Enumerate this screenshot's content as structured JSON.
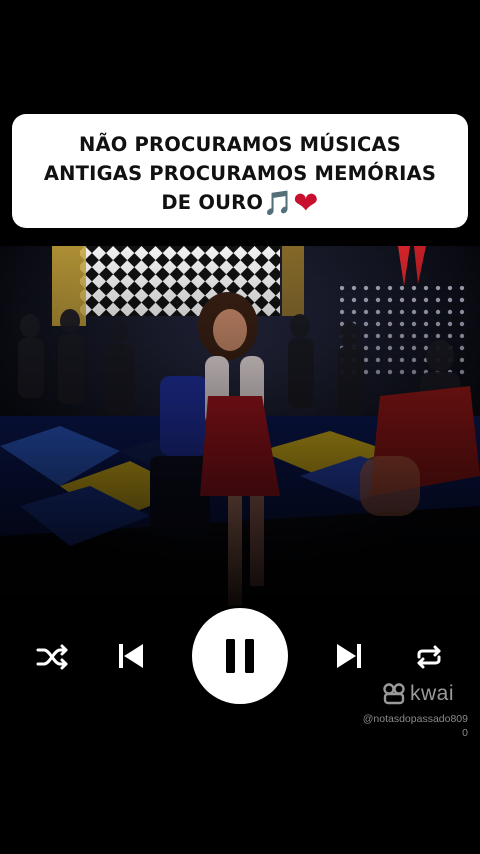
{
  "caption": {
    "line1": "NÃO PROCURAMOS MÚSICAS",
    "line2": "ANTIGAS PROCURAMOS MEMÓRIAS",
    "line3": "DE OURO",
    "note_emoji": "🎵",
    "heart_emoji": "❤"
  },
  "player": {
    "state": "playing",
    "icons": [
      "shuffle-icon",
      "skip-previous-icon",
      "pause-icon",
      "skip-next-icon",
      "repeat-icon"
    ]
  },
  "watermark": {
    "brand": "kwai",
    "handle": "@notasdopassado8090"
  },
  "colors": {
    "background": "#000000",
    "caption_bg": "#ffffff",
    "heart": "#c8102e",
    "controls": "#ffffff",
    "watermark": "#9a9a9a"
  }
}
